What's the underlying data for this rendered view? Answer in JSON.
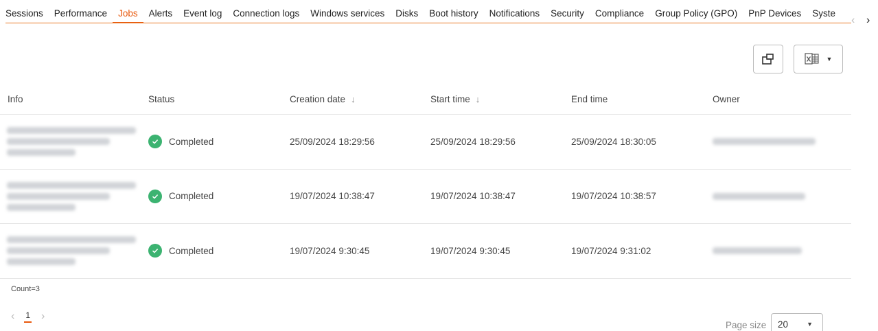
{
  "tabs": [
    {
      "label": "Sessions"
    },
    {
      "label": "Performance"
    },
    {
      "label": "Jobs",
      "active": true
    },
    {
      "label": "Alerts"
    },
    {
      "label": "Event log"
    },
    {
      "label": "Connection logs"
    },
    {
      "label": "Windows services"
    },
    {
      "label": "Disks"
    },
    {
      "label": "Boot history"
    },
    {
      "label": "Notifications"
    },
    {
      "label": "Security"
    },
    {
      "label": "Compliance"
    },
    {
      "label": "Group Policy (GPO)"
    },
    {
      "label": "PnP Devices"
    },
    {
      "label": "Syste"
    }
  ],
  "table": {
    "headers": {
      "info": "Info",
      "status": "Status",
      "creation_date": "Creation date",
      "start_time": "Start time",
      "end_time": "End time",
      "owner": "Owner"
    },
    "sort_arrow": "↓",
    "rows": [
      {
        "status": "Completed",
        "creation_date": "25/09/2024 18:29:56",
        "start_time": "25/09/2024 18:29:56",
        "end_time": "25/09/2024 18:30:05"
      },
      {
        "status": "Completed",
        "creation_date": "19/07/2024 10:38:47",
        "start_time": "19/07/2024 10:38:47",
        "end_time": "19/07/2024 10:38:57"
      },
      {
        "status": "Completed",
        "creation_date": "19/07/2024 9:30:45",
        "start_time": "19/07/2024 9:30:45",
        "end_time": "19/07/2024 9:31:02"
      }
    ]
  },
  "count": "Count=3",
  "pager": {
    "current_page": "1"
  },
  "page_size": {
    "label": "Page size",
    "value": "20"
  },
  "colors": {
    "accent": "#e8580c",
    "success": "#3cb371"
  }
}
